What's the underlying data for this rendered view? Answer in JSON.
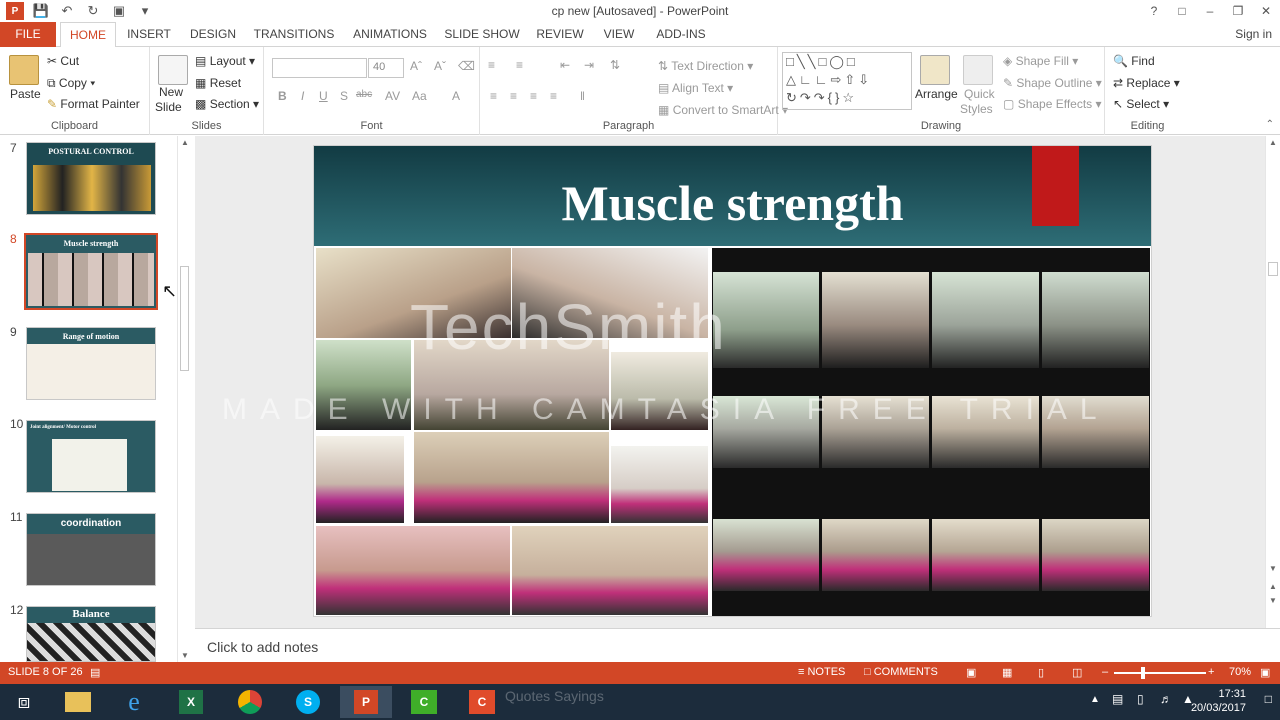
{
  "window": {
    "title": "cp new [Autosaved] - PowerPoint",
    "signin": "Sign in"
  },
  "tabs": [
    "FILE",
    "HOME",
    "INSERT",
    "DESIGN",
    "TRANSITIONS",
    "ANIMATIONS",
    "SLIDE SHOW",
    "REVIEW",
    "VIEW",
    "ADD-INS"
  ],
  "ribbon": {
    "clipboard": {
      "paste": "Paste",
      "cut": "Cut",
      "copy": "Copy",
      "format_painter": "Format Painter",
      "label": "Clipboard"
    },
    "slides": {
      "new_slide_1": "New",
      "new_slide_2": "Slide",
      "layout": "Layout",
      "reset": "Reset",
      "section": "Section",
      "label": "Slides"
    },
    "font": {
      "size": "40",
      "bold": "B",
      "italic": "I",
      "underline": "U",
      "shadow": "S",
      "strike": "abc",
      "label": "Font"
    },
    "paragraph": {
      "text_direction": "Text Direction",
      "align_text": "Align Text",
      "convert_smartart": "Convert to SmartArt",
      "label": "Paragraph"
    },
    "drawing": {
      "arrange": "Arrange",
      "quick_styles_1": "Quick",
      "quick_styles_2": "Styles",
      "shape_fill": "Shape Fill",
      "shape_outline": "Shape Outline",
      "shape_effects": "Shape Effects",
      "label": "Drawing"
    },
    "editing": {
      "find": "Find",
      "replace": "Replace",
      "select": "Select",
      "label": "Editing"
    }
  },
  "thumbnails": [
    {
      "num": "7",
      "title": "POSTURAL CONTROL"
    },
    {
      "num": "8",
      "title": "Muscle strength"
    },
    {
      "num": "9",
      "title": "Range of motion"
    },
    {
      "num": "10",
      "title": "Joint alignment/ Motor control"
    },
    {
      "num": "11",
      "title": "coordination"
    },
    {
      "num": "12",
      "title": "Balance"
    }
  ],
  "slide": {
    "title": "Muscle strength"
  },
  "watermark": {
    "line1": "TechSmith",
    "line2": "MADE WITH CAMTASIA FREE TRIAL"
  },
  "notes": {
    "placeholder": "Click to add notes"
  },
  "statusbar": {
    "slide_counter": "SLIDE 8 OF 26",
    "notes": "NOTES",
    "comments": "COMMENTS",
    "zoom": "70%"
  },
  "taskbar": {
    "ghost_text": "Quotes Sayings",
    "time": "17:31",
    "date": "20/03/2017"
  },
  "colors": {
    "accent": "#d24726",
    "slide_header": "#1f535b",
    "flag": "#c0191a"
  }
}
